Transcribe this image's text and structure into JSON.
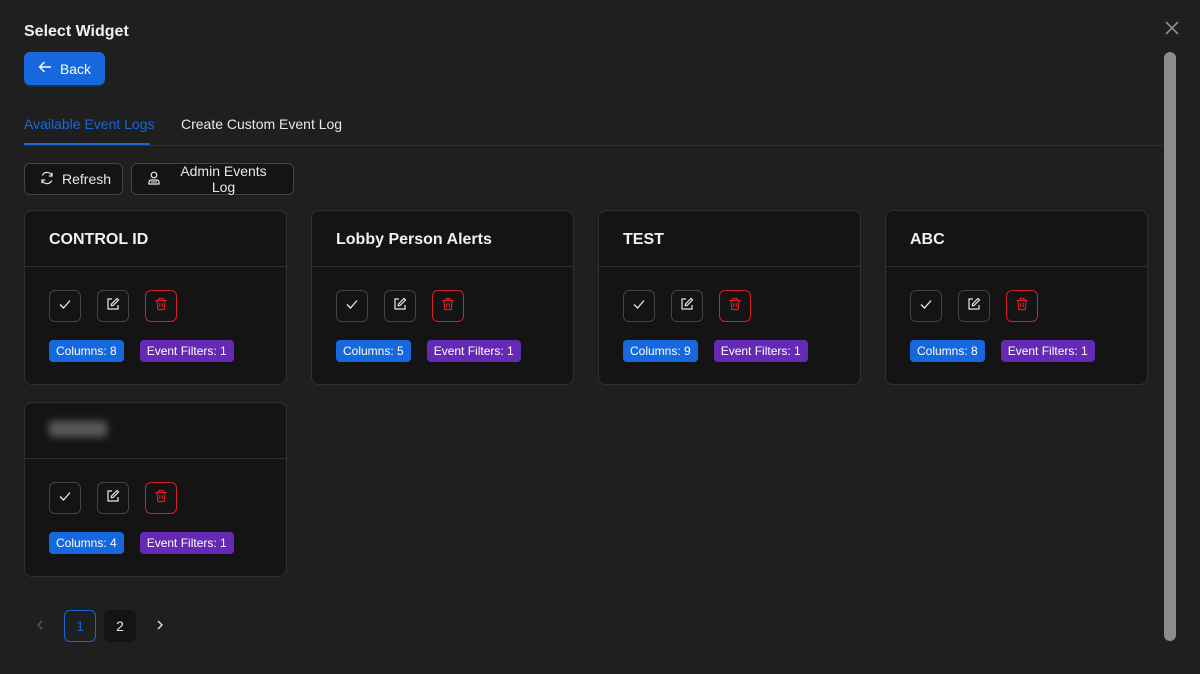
{
  "modal": {
    "title": "Select Widget",
    "close_icon": "close-icon"
  },
  "back_button": {
    "label": "Back",
    "icon": "arrow-left-icon"
  },
  "tabs": [
    {
      "label": "Available Event Logs",
      "active": true
    },
    {
      "label": "Create Custom Event Log",
      "active": false
    }
  ],
  "toolbar": {
    "refresh_label": "Refresh",
    "admin_label": "Admin Events Log"
  },
  "cards": [
    {
      "title": "CONTROL ID",
      "columns": "Columns: 8",
      "filters": "Event Filters: 1"
    },
    {
      "title": "Lobby Person Alerts",
      "columns": "Columns: 5",
      "filters": "Event Filters: 1"
    },
    {
      "title": "TEST",
      "columns": "Columns: 9",
      "filters": "Event Filters: 1"
    },
    {
      "title": "ABC",
      "columns": "Columns: 8",
      "filters": "Event Filters: 1"
    },
    {
      "title": "",
      "columns": "Columns: 4",
      "filters": "Event Filters: 1"
    }
  ],
  "pagination": {
    "pages": [
      "1",
      "2"
    ],
    "current": "1"
  },
  "colors": {
    "primary": "#1668dc",
    "purple": "#642ab5",
    "danger": "#d32029",
    "background": "#1f1f1f"
  }
}
